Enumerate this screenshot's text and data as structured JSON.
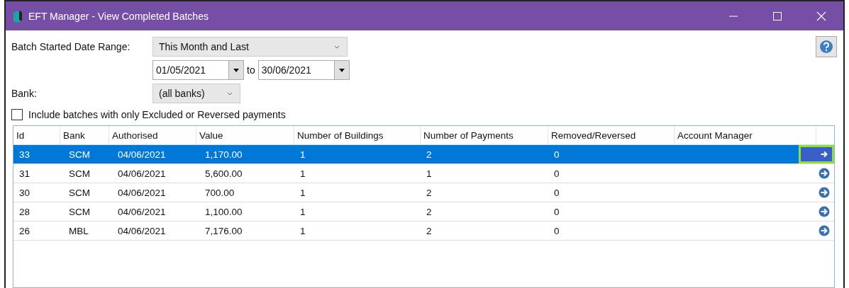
{
  "window": {
    "title": "EFT Manager - View Completed Batches"
  },
  "filters": {
    "date_range_label": "Batch Started Date Range:",
    "date_range_value": "This Month and Last",
    "date_from": "01/05/2021",
    "date_to_label": "to",
    "date_to": "30/06/2021",
    "bank_label": "Bank:",
    "bank_value": "(all banks)",
    "include_excluded": {
      "label": "Include batches with only Excluded or Reversed payments",
      "checked": false
    }
  },
  "table": {
    "columns": [
      "Id",
      "Bank",
      "Authorised",
      "Value",
      "Number of Buildings",
      "Number of Payments",
      "Removed/Reversed",
      "Account Manager"
    ],
    "rows": [
      {
        "cells": [
          "33",
          "SCM",
          "04/06/2021",
          "1,170.00",
          "1",
          "2",
          "0",
          ""
        ],
        "selected": true
      },
      {
        "cells": [
          "31",
          "SCM",
          "04/06/2021",
          "5,600.00",
          "1",
          "1",
          "0",
          ""
        ],
        "selected": false
      },
      {
        "cells": [
          "30",
          "SCM",
          "04/06/2021",
          "700.00",
          "1",
          "2",
          "0",
          ""
        ],
        "selected": false
      },
      {
        "cells": [
          "28",
          "SCM",
          "04/06/2021",
          "1,100.00",
          "1",
          "2",
          "0",
          ""
        ],
        "selected": false
      },
      {
        "cells": [
          "26",
          "MBL",
          "04/06/2021",
          "7,176.00",
          "1",
          "2",
          "0",
          ""
        ],
        "selected": false
      }
    ]
  }
}
